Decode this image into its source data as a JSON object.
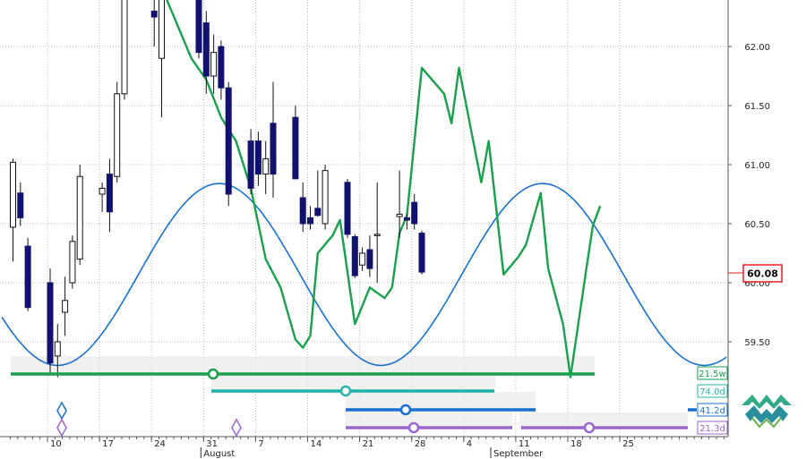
{
  "chart_data": {
    "type": "candlestick",
    "y_ticks": [
      "59.50",
      "60.00",
      "60.50",
      "61.00",
      "61.50",
      "62.00"
    ],
    "ylim": [
      59.0,
      62.4
    ],
    "x_ticks": [
      "10",
      "17",
      "24",
      "31",
      "7",
      "14",
      "21",
      "28",
      "4",
      "11",
      "18",
      "25"
    ],
    "months": [
      "August",
      "September"
    ],
    "last_price": "60.08",
    "candles": [
      {
        "t": 0,
        "o": 60.47,
        "h": 61.05,
        "l": 60.18,
        "c": 61.02,
        "col": "white"
      },
      {
        "t": 1,
        "o": 60.76,
        "h": 60.85,
        "l": 60.48,
        "c": 60.55,
        "col": "navy"
      },
      {
        "t": 2,
        "o": 60.31,
        "h": 60.38,
        "l": 59.76,
        "c": 59.79,
        "col": "navy"
      },
      {
        "t": 5,
        "o": 60.0,
        "h": 60.12,
        "l": 59.23,
        "c": 59.32,
        "col": "navy"
      },
      {
        "t": 6,
        "o": 59.38,
        "h": 59.65,
        "l": 59.2,
        "c": 59.5,
        "col": "white"
      },
      {
        "t": 7,
        "o": 59.75,
        "h": 60.05,
        "l": 59.55,
        "c": 59.85,
        "col": "white"
      },
      {
        "t": 8,
        "o": 60.0,
        "h": 60.4,
        "l": 59.95,
        "c": 60.35,
        "col": "white"
      },
      {
        "t": 9,
        "o": 60.2,
        "h": 61.0,
        "l": 60.15,
        "c": 60.9,
        "col": "white"
      },
      {
        "t": 12,
        "o": 60.75,
        "h": 60.85,
        "l": 60.6,
        "c": 60.8,
        "col": "white"
      },
      {
        "t": 13,
        "o": 60.6,
        "h": 61.05,
        "l": 60.43,
        "c": 60.92,
        "col": "navy"
      },
      {
        "t": 14,
        "o": 60.9,
        "h": 61.7,
        "l": 60.85,
        "c": 61.6,
        "col": "white"
      },
      {
        "t": 15,
        "o": 61.6,
        "h": 62.5,
        "l": 61.55,
        "c": 62.4,
        "col": "white"
      },
      {
        "t": 19,
        "o": 62.3,
        "h": 62.45,
        "l": 62.0,
        "c": 62.25,
        "col": "navy"
      },
      {
        "t": 20,
        "o": 61.9,
        "h": 62.5,
        "l": 61.4,
        "c": 62.4,
        "col": "white"
      },
      {
        "t": 25,
        "o": 62.4,
        "h": 62.45,
        "l": 61.9,
        "c": 61.95,
        "col": "navy"
      },
      {
        "t": 26,
        "o": 62.2,
        "h": 62.3,
        "l": 61.6,
        "c": 61.75,
        "col": "navy"
      },
      {
        "t": 27,
        "o": 61.75,
        "h": 62.1,
        "l": 61.6,
        "c": 61.95,
        "col": "white"
      },
      {
        "t": 28,
        "o": 62.0,
        "h": 62.05,
        "l": 61.55,
        "c": 61.65,
        "col": "navy"
      },
      {
        "t": 29,
        "o": 61.65,
        "h": 61.7,
        "l": 60.65,
        "c": 60.75,
        "col": "navy"
      },
      {
        "t": 32,
        "o": 61.2,
        "h": 61.3,
        "l": 60.75,
        "c": 60.8,
        "col": "navy"
      },
      {
        "t": 33,
        "o": 61.2,
        "h": 61.28,
        "l": 60.82,
        "c": 60.92,
        "col": "navy"
      },
      {
        "t": 34,
        "o": 60.92,
        "h": 61.2,
        "l": 60.75,
        "c": 61.05,
        "col": "white"
      },
      {
        "t": 35,
        "o": 61.35,
        "h": 61.7,
        "l": 60.72,
        "c": 60.92,
        "col": "navy"
      },
      {
        "t": 38,
        "o": 61.4,
        "h": 61.5,
        "l": 60.88,
        "c": 60.88,
        "col": "navy"
      },
      {
        "t": 39,
        "o": 60.72,
        "h": 60.85,
        "l": 60.43,
        "c": 60.5,
        "col": "navy"
      },
      {
        "t": 40,
        "o": 60.5,
        "h": 60.65,
        "l": 60.45,
        "c": 60.55,
        "col": "navy"
      },
      {
        "t": 41,
        "o": 60.57,
        "h": 60.95,
        "l": 60.56,
        "c": 60.63,
        "col": "navy"
      },
      {
        "t": 42,
        "o": 60.5,
        "h": 61.0,
        "l": 60.45,
        "c": 60.95,
        "col": "white"
      },
      {
        "t": 45,
        "o": 60.85,
        "h": 60.88,
        "l": 60.38,
        "c": 60.41,
        "col": "navy"
      },
      {
        "t": 46,
        "o": 60.39,
        "h": 60.41,
        "l": 60.04,
        "c": 60.06,
        "col": "navy"
      },
      {
        "t": 47,
        "o": 60.15,
        "h": 60.3,
        "l": 60.1,
        "c": 60.25,
        "col": "white"
      },
      {
        "t": 48,
        "o": 60.28,
        "h": 60.4,
        "l": 60.05,
        "c": 60.12,
        "col": "navy"
      },
      {
        "t": 49,
        "o": 60.4,
        "h": 60.85,
        "l": 60.0,
        "c": 60.41,
        "col": "white"
      },
      {
        "t": 52,
        "o": 60.58,
        "h": 60.95,
        "l": 60.38,
        "c": 60.56,
        "col": "white"
      },
      {
        "t": 53,
        "o": 60.55,
        "h": 60.58,
        "l": 60.45,
        "c": 60.53,
        "col": "navy"
      },
      {
        "t": 54,
        "o": 60.68,
        "h": 60.75,
        "l": 60.45,
        "c": 60.5,
        "col": "navy"
      },
      {
        "t": 55,
        "o": 60.42,
        "h": 60.44,
        "l": 60.07,
        "c": 60.09,
        "col": "navy"
      }
    ],
    "series": [
      {
        "color": "#1a9f4c",
        "points": [
          [
            51,
            59.96
          ],
          [
            52,
            60.42
          ],
          [
            53,
            60.57
          ],
          [
            55,
            61.82
          ],
          [
            58,
            61.6
          ],
          [
            59,
            61.35
          ],
          [
            60,
            61.82
          ],
          [
            63,
            60.85
          ],
          [
            64,
            61.2
          ],
          [
            66,
            60.07
          ],
          [
            68,
            60.22
          ],
          [
            69,
            60.32
          ],
          [
            71,
            60.76
          ],
          [
            72,
            60.12
          ],
          [
            74,
            59.65
          ],
          [
            75,
            59.2
          ],
          [
            77,
            60.06
          ],
          [
            78,
            60.48
          ],
          [
            79,
            60.65
          ]
        ]
      },
      {
        "color": "#1a9f4c",
        "points": [
          [
            20,
            62.5
          ],
          [
            22,
            62.2
          ],
          [
            24,
            61.9
          ],
          [
            26,
            61.72
          ],
          [
            28,
            61.4
          ],
          [
            30,
            61.2
          ],
          [
            32,
            60.8
          ],
          [
            34,
            60.2
          ],
          [
            36,
            59.96
          ],
          [
            38,
            59.52
          ],
          [
            39,
            59.45
          ],
          [
            40,
            59.55
          ],
          [
            41,
            60.25
          ],
          [
            43,
            60.4
          ],
          [
            44,
            60.53
          ],
          [
            46,
            59.65
          ],
          [
            48,
            59.96
          ],
          [
            50,
            59.87
          ],
          [
            51,
            59.96
          ]
        ]
      },
      {
        "color": "#1a6fd1",
        "sine": {
          "t0": 6,
          "period": 43.5,
          "mid": 60.07,
          "amp": 0.77
        }
      }
    ],
    "cycle_bars": [
      {
        "label": "21.5w",
        "color": "#1a9f4c"
      },
      {
        "label": "74.0d",
        "color": "#22b3a8"
      },
      {
        "label": "41.2d",
        "color": "#1a6fd1"
      },
      {
        "label": "21.3d",
        "color": "#9966cc"
      }
    ],
    "accent_colors": {
      "candle_down": "#11116e",
      "last_price_border": "#e02020",
      "grid": "#b8b8b8"
    }
  }
}
